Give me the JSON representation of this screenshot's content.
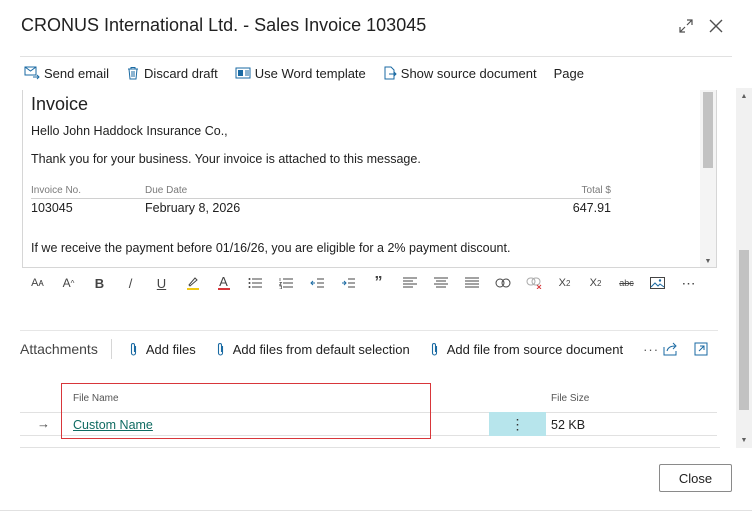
{
  "dialog": {
    "title": "CRONUS International Ltd. - Sales Invoice 103045",
    "expand_icon": "expand-icon",
    "close_icon": "close-icon"
  },
  "toolbar": {
    "send_email": "Send email",
    "discard_draft": "Discard draft",
    "use_word_template": "Use Word template",
    "show_source_document": "Show source document",
    "page": "Page"
  },
  "invoice": {
    "title": "Invoice",
    "greeting": "Hello John Haddock Insurance Co.,",
    "thanks": "Thank you for your business. Your invoice is attached to this message.",
    "headers": {
      "invoice_no": "Invoice No.",
      "due_date": "Due Date",
      "total": "Total $"
    },
    "values": {
      "invoice_no": "103045",
      "due_date": "February 8, 2026",
      "total": "647.91"
    },
    "discount_note": "If we receive the payment before 01/16/26, you are eligible for a 2% payment discount."
  },
  "formatting": {
    "font_size": "Aᴀ",
    "font_color": "A",
    "bold": "B",
    "italic": "/",
    "underline": "U",
    "text_color": "A",
    "quote": "”",
    "superscript": "X²",
    "subscript": "X₂",
    "strikethrough": "abc",
    "more": "⋯"
  },
  "attachments": {
    "title": "Attachments",
    "add_files": "Add files",
    "add_from_default": "Add files from default selection",
    "add_from_source": "Add file from source document",
    "more": "···",
    "columns": {
      "file_name": "File Name",
      "file_size": "File Size"
    },
    "rows": [
      {
        "name": "Custom Name",
        "size": "52 KB"
      }
    ],
    "row_arrow": "→",
    "row_menu": "⋮"
  },
  "footer": {
    "close": "Close"
  },
  "colors": {
    "link": "#0f6b62",
    "accent": "#1a6aa3",
    "selection_cell": "#b7e5ec",
    "highlight_box": "#d8363a"
  }
}
